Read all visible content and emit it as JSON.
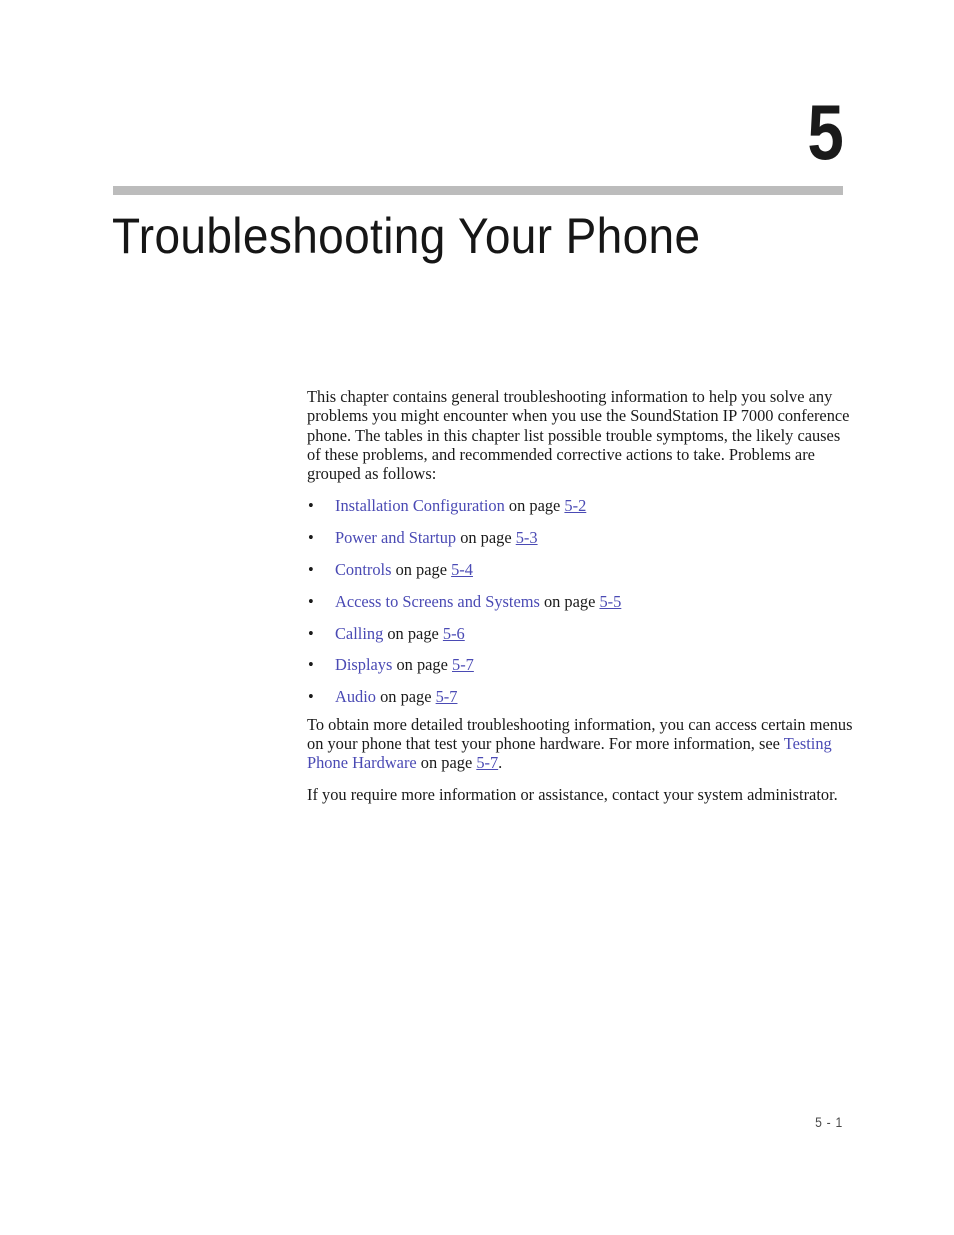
{
  "chapter": {
    "number": "5",
    "title": "Troubleshooting Your Phone",
    "rule_color": "#bcbcbc"
  },
  "intro_paragraph": "This chapter contains general troubleshooting information to help you solve any problems you might encounter when you use the SoundStation IP 7000 conference phone. The tables in this chapter list possible trouble symptoms, the likely causes of these problems, and recommended corrective actions to take. Problems are grouped as follows:",
  "link_color": "#4a4ab4",
  "bullet_char": "•",
  "topics": [
    {
      "link": "Installation Configuration",
      "connector": " on page ",
      "page": "5-2"
    },
    {
      "link": "Power and Startup",
      "connector": " on page ",
      "page": "5-3"
    },
    {
      "link": "Controls",
      "connector": " on page ",
      "page": "5-4"
    },
    {
      "link": "Access to Screens and Systems",
      "connector": " on page ",
      "page": "5-5"
    },
    {
      "link": "Calling",
      "connector": " on page ",
      "page": "5-6"
    },
    {
      "link": "Displays",
      "connector": " on page ",
      "page": "5-7"
    },
    {
      "link": "Audio",
      "connector": " on page ",
      "page": "5-7"
    }
  ],
  "closing": {
    "testing_lead": "To obtain more detailed troubleshooting information, you can access certain menus on your phone that test your phone hardware. For more information, see ",
    "testing_link": "Testing Phone Hardware",
    "testing_connector": " on page ",
    "testing_page": "5-7",
    "testing_end": ".",
    "assistance_paragraph": "If you require more information or assistance, contact your system administrator."
  },
  "footer": {
    "folio": "5 - 1"
  }
}
